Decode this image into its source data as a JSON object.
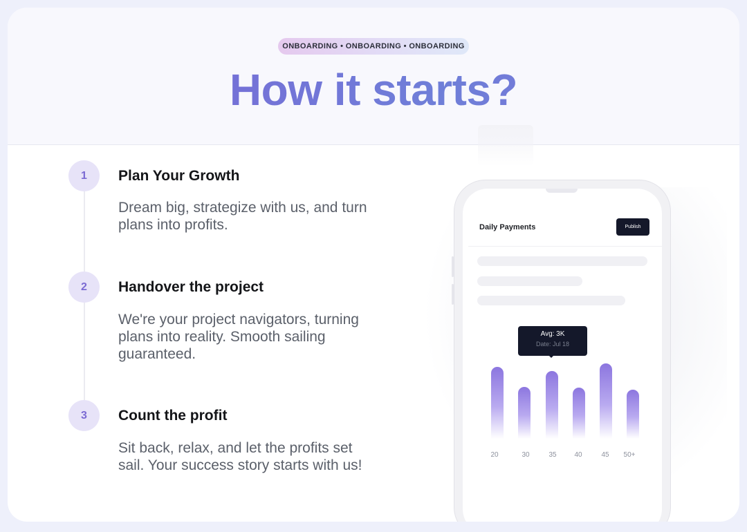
{
  "header": {
    "tag": "ONBOARDING • ONBOARDING • ONBOARDING",
    "title": "How it starts?"
  },
  "steps": [
    {
      "num": "1",
      "title": "Plan Your Growth",
      "desc": "Dream big, strategize with us, and turn plans into profits."
    },
    {
      "num": "2",
      "title": "Handover the project",
      "desc": "We're your project navigators, turning plans into reality. Smooth sailing guaranteed."
    },
    {
      "num": "3",
      "title": "Count the profit",
      "desc": "Sit back, relax, and let the profits set sail. Your success story starts with us!"
    }
  ],
  "phone": {
    "app_title": "Daily Payments",
    "publish_label": "Publish",
    "tooltip": {
      "line1": "Avg: 3K",
      "line2": "Date: Jul 18"
    },
    "bar_color": "#8c76df"
  },
  "chart_data": {
    "type": "bar",
    "categories": [
      "20",
      "30",
      "35",
      "40",
      "45",
      "50+"
    ],
    "values": [
      90,
      65,
      85,
      64,
      95,
      62
    ],
    "title": "",
    "xlabel": "",
    "ylabel": ""
  }
}
